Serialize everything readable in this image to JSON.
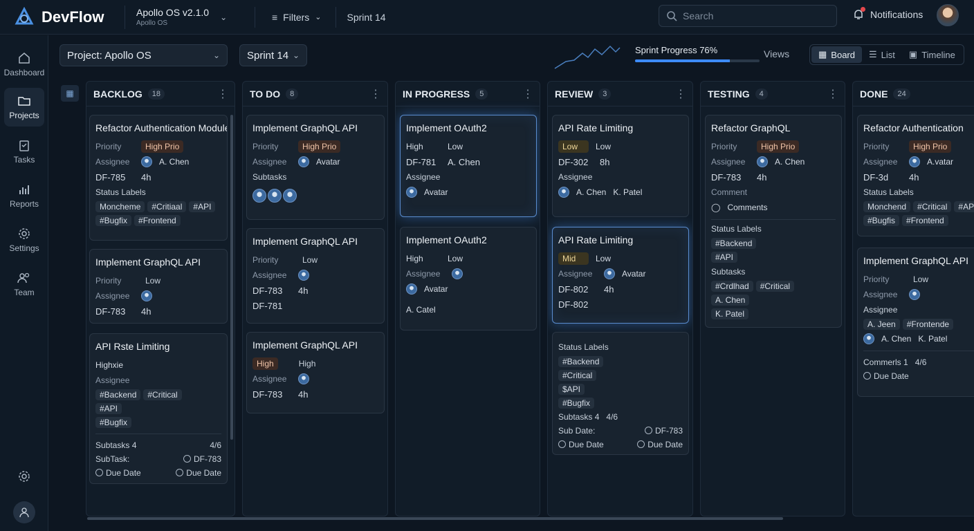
{
  "app": {
    "name": "DevFlow"
  },
  "project_switcher": {
    "name": "Apollo OS v2.1.0",
    "sub": "Apollo OS"
  },
  "topbar": {
    "filters_label": "Filters",
    "sprint_label": "Sprint 14",
    "search_placeholder": "Search",
    "notifications_label": "Notifications"
  },
  "sidebar": {
    "items": [
      {
        "label": "Dashboard",
        "icon": "home-icon"
      },
      {
        "label": "Projects",
        "icon": "folder-icon",
        "active": true
      },
      {
        "label": "Tasks",
        "icon": "clipboard-icon"
      },
      {
        "label": "Reports",
        "icon": "bar-chart-icon"
      },
      {
        "label": "Settings",
        "icon": "gear-icon"
      },
      {
        "label": "Team",
        "icon": "users-icon"
      }
    ]
  },
  "toolbar": {
    "project_select": "Project: Apollo OS",
    "sprint_select": "Sprint 14",
    "sprint_progress_label": "Sprint Progress 76%",
    "sprint_progress_value": 0.76,
    "views_label": "Views",
    "views": [
      "Board",
      "List",
      "Timeline"
    ],
    "active_view": "Board"
  },
  "columns": [
    {
      "title": "BACKLOG",
      "count": "18",
      "cards": [
        {
          "title": "Refactor Authentication Module",
          "priority_label": "Priority",
          "priority": "High Prio",
          "assignee_label": "Assignee",
          "assignee": "A. Chen",
          "id": "DF-785",
          "estimate": "4h",
          "labels_title": "Status Labels",
          "labels": [
            "Moncheme",
            "#Critiaal",
            "#API",
            "#Bugfix",
            "#Frontend"
          ]
        },
        {
          "title": "Implement GraphQL API",
          "priority_label": "Priority",
          "priority": "Low",
          "assignee_label": "Assignee",
          "id": "DF-783",
          "estimate": "4h"
        },
        {
          "title": "API Rste Limiting",
          "priority_text": "Highxie",
          "assignee_label": "Assignee",
          "labels": [
            "#Backend",
            "#Critical",
            "#API",
            "#Bugfix"
          ],
          "subtasks_label": "Subtasks",
          "subtasks_count": "4",
          "subtasks_progress": "4/6",
          "subtask_label": "SubTask:",
          "subtask_id": "DF-783",
          "due_left": "Due Date",
          "due_right": "Due Date"
        }
      ]
    },
    {
      "title": "TO DO",
      "count": "8",
      "cards": [
        {
          "title": "Implement GraphQL API",
          "priority_label": "Priority",
          "priority": "High Prio",
          "assignee_label": "Assignee",
          "assignee": "Avatar",
          "subtasks_label": "Subtasks"
        },
        {
          "title": "Implement GraphQL API",
          "priority_label": "Priority",
          "priority": "Low",
          "assignee_label": "Assignee",
          "id": "DF-783",
          "estimate": "4h",
          "id2": "DF-781"
        },
        {
          "title": "Implement GraphQL API",
          "priority": "High",
          "priority2": "High",
          "assignee_label": "Assignee",
          "id": "DF-783",
          "estimate": "4h"
        }
      ]
    },
    {
      "title": "IN PROGRESS",
      "count": "5",
      "cards": [
        {
          "title": "Implement OAuth2",
          "priority": "High",
          "priority2": "Low",
          "id": "DF-781",
          "assignee": "A. Chen",
          "assignee_label": "Assignee",
          "assignee2": "Avatar"
        },
        {
          "title": "Implement OAuth2",
          "priority": "High",
          "priority2": "Low",
          "assignee_label": "Assignee",
          "assignee": "Avatar",
          "assignee2": "A. Catel"
        }
      ]
    },
    {
      "title": "REVIEW",
      "count": "3",
      "cards": [
        {
          "title": "API Rate Limiting",
          "priority": "Low",
          "priority2": "Low",
          "id": "DF-302",
          "estimate": "8h",
          "assignee_label": "Assignee",
          "assignee": "A. Chen",
          "assignee2": "K. Patel"
        },
        {
          "title": "API Rate Limiting",
          "priority": "Mid",
          "priority2": "Low",
          "assignee_label": "Assignee",
          "assignee": "Avatar",
          "id": "DF-802",
          "estimate": "4h",
          "id2": "DF-802"
        },
        {
          "labels_title": "Status Labels",
          "labels": [
            "#Backend",
            "#Critical",
            "$API",
            "#Bugfix"
          ],
          "subtasks_label": "Subtasks",
          "subtasks_count": "4",
          "subtasks_progress": "4/6",
          "sub_date_label": "Sub Date:",
          "sub_date_id": "DF-783",
          "due_left": "Due Date",
          "due_right": "Due Date"
        }
      ]
    },
    {
      "title": "TESTING",
      "count": "4",
      "cards": [
        {
          "title": "Refactor GraphQL",
          "priority_label": "Priority",
          "priority": "High Prio",
          "assignee_label": "Assignee",
          "assignee": "A. Chen",
          "id": "DF-783",
          "estimate": "4h",
          "comment_label": "Comment",
          "comments": "Comments",
          "labels_title": "Status Labels",
          "labels": [
            "#Backend",
            "#API"
          ],
          "subtasks_label": "Subtasks",
          "subtask_tags": [
            "#Crdlhad",
            "#Critical"
          ],
          "people": [
            "A. Chen",
            "K. Patel"
          ]
        }
      ]
    },
    {
      "title": "DONE",
      "count": "24",
      "cards": [
        {
          "title": "Refactor Authentication",
          "priority_label": "Priority",
          "priority": "High Prio",
          "assignee_label": "Assignee",
          "assignee": "A.vatar",
          "id": "DF-3d",
          "estimate": "4h",
          "labels_title": "Status Labels",
          "labels": [
            "Monchend",
            "#Critical",
            "#AP",
            "#Bugfis",
            "#Frontend"
          ]
        },
        {
          "title": "Implement GraphQL API",
          "priority_label": "Priority",
          "priority": "Low",
          "assignee_label": "Assignee",
          "assignee_label2": "Assignee",
          "tags": [
            "A. Jeen",
            "#Frontende"
          ],
          "people": [
            "A. Chen",
            "K. Patel"
          ],
          "comments": "Commerls 1",
          "progress": "4/6",
          "due": "Due Date"
        }
      ]
    }
  ]
}
